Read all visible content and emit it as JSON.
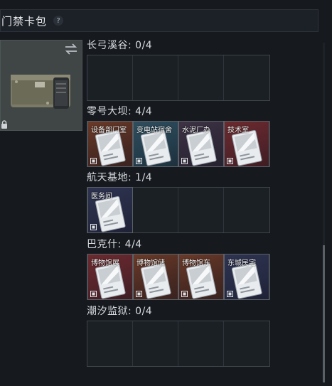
{
  "header": {
    "title": "门禁卡包",
    "help": "?"
  },
  "icons": {
    "help": "question-icon",
    "swap": "swap-arrows-icon",
    "lock": "lock-icon",
    "slot_corner": "card-mini-icon"
  },
  "sections": [
    {
      "title": "长弓溪谷: 0/4",
      "slots": [
        {
          "label": "",
          "color": "empty"
        },
        {
          "label": "",
          "color": "empty"
        },
        {
          "label": "",
          "color": "empty"
        },
        {
          "label": "",
          "color": "empty"
        }
      ]
    },
    {
      "title": "零号大坝: 4/4",
      "slots": [
        {
          "label": "设备部门室",
          "color": "rust"
        },
        {
          "label": "变电站宿舍",
          "color": "teal"
        },
        {
          "label": "水泥厂办",
          "color": "plum"
        },
        {
          "label": "技术室",
          "color": "red"
        }
      ]
    },
    {
      "title": "航天基地: 1/4",
      "slots": [
        {
          "label": "医务间",
          "color": "navy"
        },
        {
          "label": "",
          "color": "empty"
        },
        {
          "label": "",
          "color": "empty"
        },
        {
          "label": "",
          "color": "empty"
        }
      ]
    },
    {
      "title": "巴克什: 4/4",
      "slots": [
        {
          "label": "博物馆展",
          "color": "red"
        },
        {
          "label": "博物馆储",
          "color": "rust"
        },
        {
          "label": "博物馆东",
          "color": "rust"
        },
        {
          "label": "东城民宅",
          "color": "navy"
        }
      ]
    },
    {
      "title": "潮汐监狱: 0/4",
      "slots": [
        {
          "label": "",
          "color": "empty"
        },
        {
          "label": "",
          "color": "empty"
        },
        {
          "label": "",
          "color": "empty"
        },
        {
          "label": "",
          "color": "empty"
        }
      ]
    }
  ]
}
